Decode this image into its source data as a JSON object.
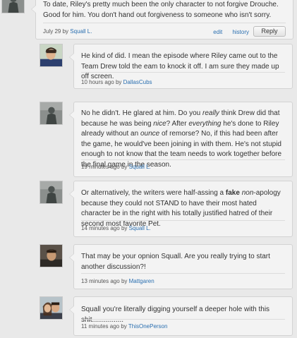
{
  "comments": [
    {
      "author": "Squall L.",
      "date": "July 29",
      "by": "by",
      "avatar_icon": "statue-avatar-icon",
      "text": "To date, Riley's pretty much been the only character to not forgive Drouche. Good for him. You don't hand out forgiveness to someone who isn't sorry.",
      "actions": {
        "edit": "edit",
        "history": "history",
        "reply": "Reply"
      }
    },
    {
      "author": "DallasCubs",
      "date": "10 hours ago",
      "by": "by",
      "avatar_icon": "person-avatar-icon",
      "text": "He kind of did. I mean the episode where Riley came out to the Team Drew told the eam to knock it off.  I am sure they made up off screen."
    },
    {
      "author": "Squall L.",
      "date": "19 minutes ago",
      "by": "by",
      "avatar_icon": "statue-avatar-icon",
      "text_parts": {
        "p1": "No he didn't. He glared at him. Do you ",
        "e1": "really",
        "p2": " think Drew did that because he was being ",
        "e2": "nice",
        "p3": "? After ",
        "e3": "everything",
        "p4": " he's done to Riley already without an ",
        "e4": "ounce",
        "p5": " of remorse? No, if this had been after the game, he would've been joining in with them. He's not stupid enough to not know that the team needs to work together before the final game in the season."
      }
    },
    {
      "author": "Squall L.",
      "date": "14 minutes ago",
      "by": "by",
      "avatar_icon": "statue-avatar-icon",
      "text_parts": {
        "p1": "Or alternatively, the writers were half-assing a ",
        "b1": "fake",
        "p2": " ",
        "e1": "non",
        "p3": "-apology because they could not STAND to have their most hated character be in the right with his totally justified hatred of their second most favorite Pet."
      }
    },
    {
      "author": "Mattgaren",
      "date": "13 minutes ago",
      "by": "by",
      "avatar_icon": "person-avatar-icon",
      "text": "That may be your opnion Squall. Are you really trying to start another discussion?!"
    },
    {
      "author": "ThisOnePerson",
      "date": "11 minutes ago",
      "by": "by",
      "avatar_icon": "couple-avatar-icon",
      "text": "Squall you're literally digging yourself a deeper hole with this shit................"
    }
  ]
}
